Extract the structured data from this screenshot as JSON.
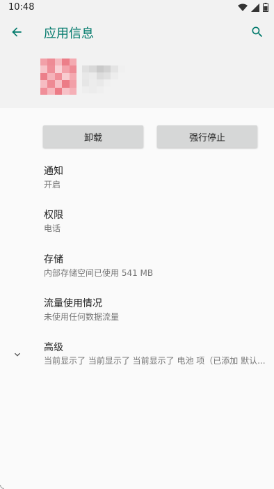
{
  "status_bar": {
    "time": "10:48",
    "icons": [
      "wifi-icon",
      "signal-icon",
      "battery-icon"
    ]
  },
  "toolbar": {
    "title": "应用信息",
    "back_icon": "arrow-back-icon",
    "search_icon": "search-icon",
    "accent_color": "#00796b"
  },
  "app_header": {
    "icon_pixelated": true,
    "name_pixelated": true
  },
  "buttons": {
    "uninstall_label": "卸载",
    "force_stop_label": "强行停止"
  },
  "settings": [
    {
      "title": "通知",
      "subtitle": "开启"
    },
    {
      "title": "权限",
      "subtitle": "电话"
    },
    {
      "title": "存储",
      "subtitle": "内部存储空间已使用 541 MB"
    },
    {
      "title": "流量使用情况",
      "subtitle": "未使用任何数据流量"
    },
    {
      "title": "高级",
      "subtitle": "当前显示了 当前显示了 当前显示了 电池 项（已添加 默认..."
    }
  ]
}
